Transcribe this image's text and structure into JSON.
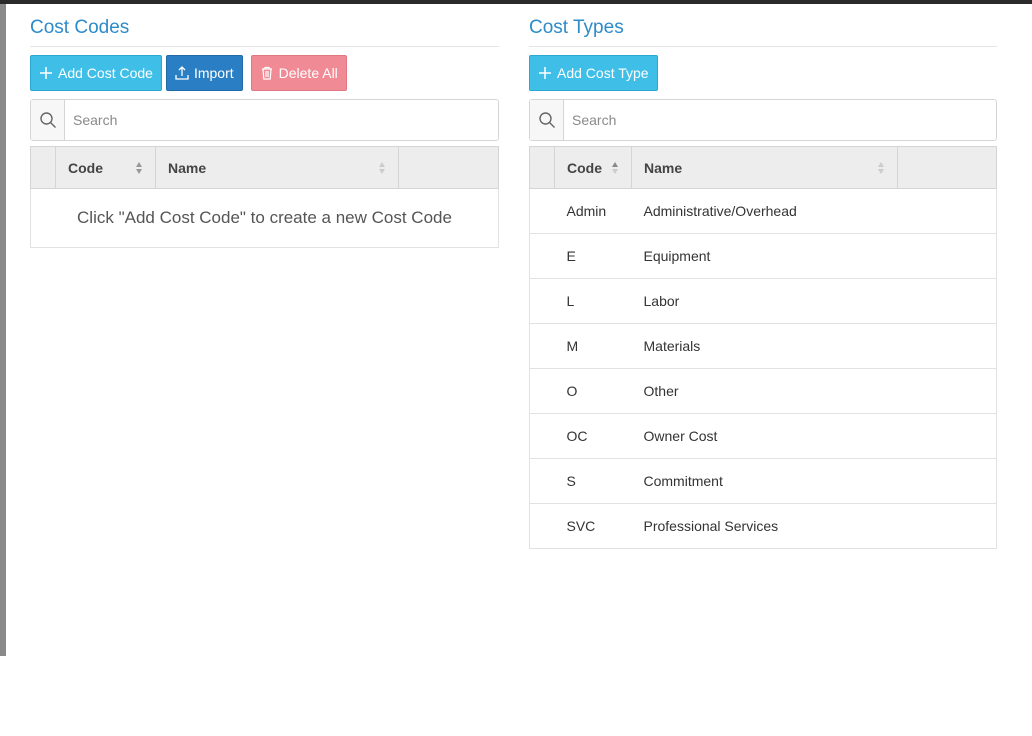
{
  "cost_codes": {
    "title": "Cost Codes",
    "buttons": {
      "add": "Add Cost Code",
      "import": "Import",
      "delete_all": "Delete All"
    },
    "search_placeholder": "Search",
    "columns": [
      "Code",
      "Name"
    ],
    "empty_message": "Click \"Add Cost Code\" to create a new Cost Code"
  },
  "cost_types": {
    "title": "Cost Types",
    "buttons": {
      "add": "Add Cost Type"
    },
    "search_placeholder": "Search",
    "columns": [
      "Code",
      "Name"
    ],
    "rows": [
      {
        "code": "Admin",
        "name": "Administrative/Overhead"
      },
      {
        "code": "E",
        "name": "Equipment"
      },
      {
        "code": "L",
        "name": "Labor"
      },
      {
        "code": "M",
        "name": "Materials"
      },
      {
        "code": "O",
        "name": "Other"
      },
      {
        "code": "OC",
        "name": "Owner Cost"
      },
      {
        "code": "S",
        "name": "Commitment"
      },
      {
        "code": "SVC",
        "name": "Professional Services"
      }
    ]
  },
  "colors": {
    "title": "#2e8bc9",
    "add_button": "#3fbfe8",
    "import_button": "#2a7fc4",
    "delete_button": "#f08b95"
  },
  "icons": {
    "add": "plus-icon",
    "import": "upload-icon",
    "delete": "trash-icon",
    "search": "search-icon",
    "sort": "sort-icon"
  }
}
